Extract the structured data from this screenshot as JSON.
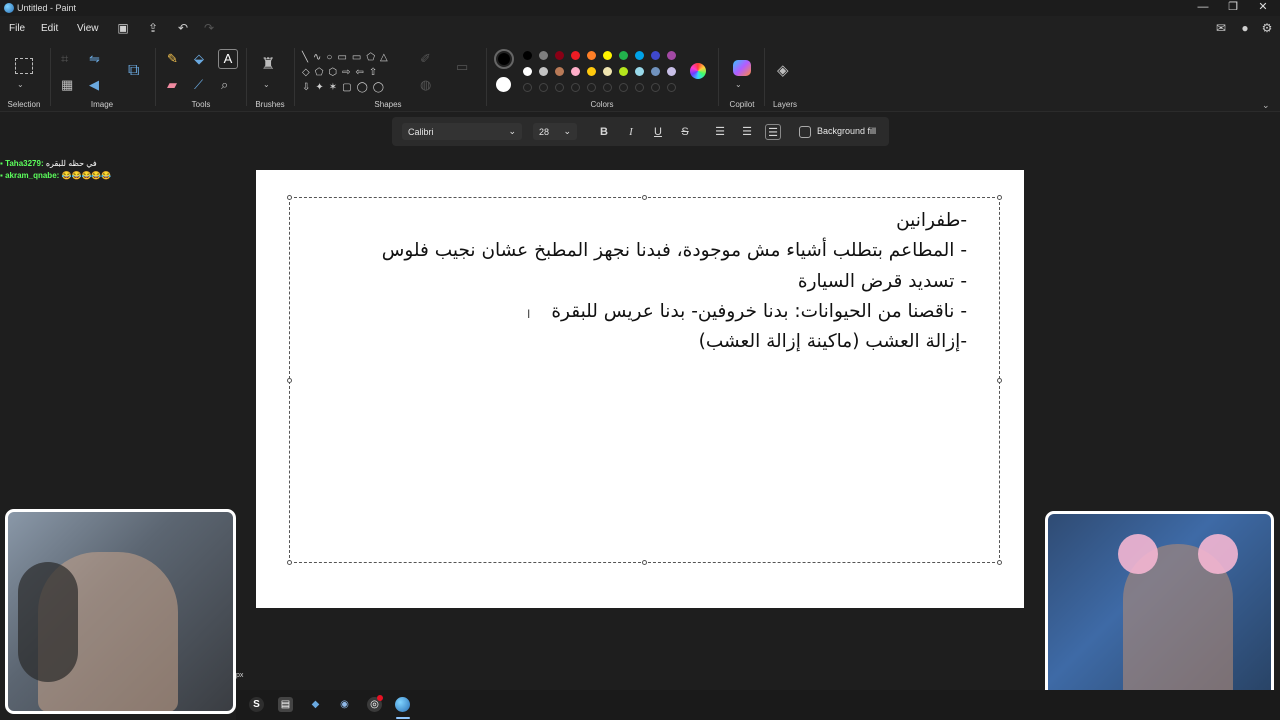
{
  "window": {
    "title": "Untitled - Paint",
    "min": "—",
    "max": "❐",
    "close": "✕"
  },
  "menu": {
    "file": "File",
    "edit": "Edit",
    "view": "View"
  },
  "ribbon": {
    "groups": {
      "selection": "Selection",
      "image": "Image",
      "tools": "Tools",
      "brushes": "Brushes",
      "shapes": "Shapes",
      "colors": "Colors",
      "copilot": "Copilot",
      "layers": "Layers"
    },
    "palette_row1": [
      "#000000",
      "#7f7f7f",
      "#880015",
      "#ed1c24",
      "#ff7f27",
      "#fff200",
      "#22b14c",
      "#00a2e8",
      "#3f48cc",
      "#a349a4"
    ],
    "palette_row2": [
      "#ffffff",
      "#c3c3c3",
      "#b97a57",
      "#ffaec9",
      "#ffc90e",
      "#efe4b0",
      "#b5e61d",
      "#99d9ea",
      "#7092be",
      "#c8bfe7"
    ],
    "primary_color": "#000000",
    "secondary_color": "#ffffff"
  },
  "text_toolbar": {
    "font": "Calibri",
    "size": "28",
    "bold": "B",
    "italic": "I",
    "underline": "U",
    "strike": "S",
    "background_fill": "Background fill"
  },
  "canvas": {
    "lines": [
      "-طفرانين",
      "- المطاعم بتطلب أشياء مش موجودة، فبدنا نجهز المطبخ عشان نجيب فلوس",
      "- تسديد قرض السيارة",
      "- ناقصنا من الحيوانات: بدنا خروفين- بدنا عريس للبقرة",
      "-إزالة العشب (ماكينة إزالة العشب)"
    ]
  },
  "chat": [
    {
      "user": "Taha3279:",
      "message": "في حظه للبقره"
    },
    {
      "user": "akram_qnabe:",
      "message": "😂😂😂😂😂"
    }
  ],
  "status": {
    "unit": "px"
  },
  "taskbar": {
    "icons": [
      "skype-icon",
      "gallery-icon",
      "app-icon",
      "steam-icon",
      "chrome-icon",
      "paint-icon"
    ],
    "skype_letter": "S"
  }
}
